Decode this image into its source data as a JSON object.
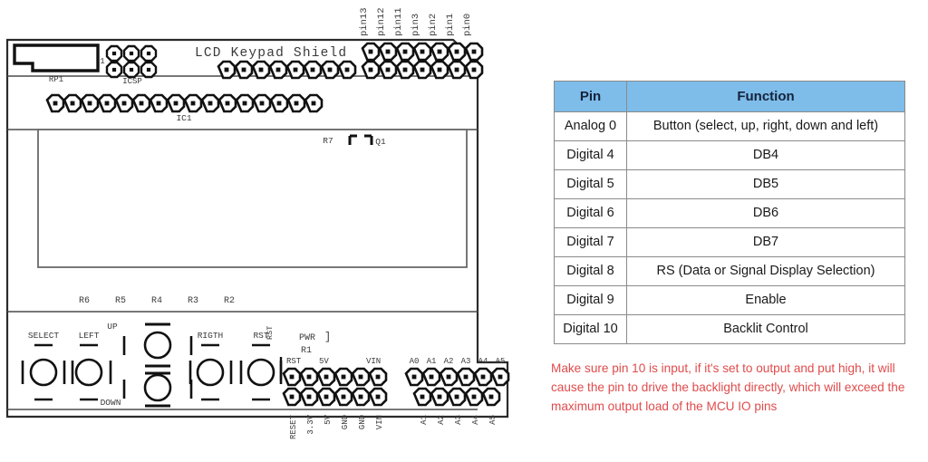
{
  "board": {
    "title": "LCD Keypad Shield",
    "refs": {
      "rp1": "RP1",
      "icsp": "ICSP",
      "ic1": "IC1",
      "r7": "R7",
      "q1": "Q1",
      "r1": "R1",
      "pwr": "PWR",
      "rst_small": "RST",
      "bracket": "]"
    },
    "resistor_labels": [
      "R6",
      "R5",
      "R4",
      "R3",
      "R2"
    ],
    "buttons": [
      {
        "name": "SELECT"
      },
      {
        "name": "LEFT"
      },
      {
        "name": "UP"
      },
      {
        "name": "DOWN"
      },
      {
        "name": "RIGTH"
      },
      {
        "name": "RST"
      }
    ],
    "digital_pin_labels": [
      "pin13",
      "pin12",
      "pin11",
      "pin3",
      "pin2",
      "pin1",
      "pin0"
    ],
    "power_top_labels": [
      "RST",
      "5V",
      "VIN"
    ],
    "power_bottom_labels": [
      "RESET",
      "3.3V",
      "5V",
      "GND",
      "GND",
      "VIN"
    ],
    "analog_top_labels": [
      "A0",
      "A1",
      "A2",
      "A3",
      "A4",
      "A5"
    ],
    "analog_bottom_labels": [
      "A1",
      "A2",
      "A3",
      "A4",
      "A5"
    ]
  },
  "table": {
    "headers": [
      "Pin",
      "Function"
    ],
    "header_bg": "#7EBDEA",
    "rows": [
      {
        "pin": "Analog 0",
        "function": "Button (select, up, right, down and left)"
      },
      {
        "pin": "Digital 4",
        "function": "DB4"
      },
      {
        "pin": "Digital 5",
        "function": "DB5"
      },
      {
        "pin": "Digital 6",
        "function": "DB6"
      },
      {
        "pin": "Digital 7",
        "function": "DB7"
      },
      {
        "pin": "Digital 8",
        "function": "RS (Data or Signal Display Selection)"
      },
      {
        "pin": "Digital 9",
        "function": "Enable"
      },
      {
        "pin": "Digital 10",
        "function": "Backlit Control"
      }
    ]
  },
  "note": {
    "color": "#E04B4B",
    "text": "Make sure pin 10 is input, if it's set to output and put high, it will cause the pin to drive the backlight directly, which will exceed the maximum output load of the MCU IO pins"
  }
}
